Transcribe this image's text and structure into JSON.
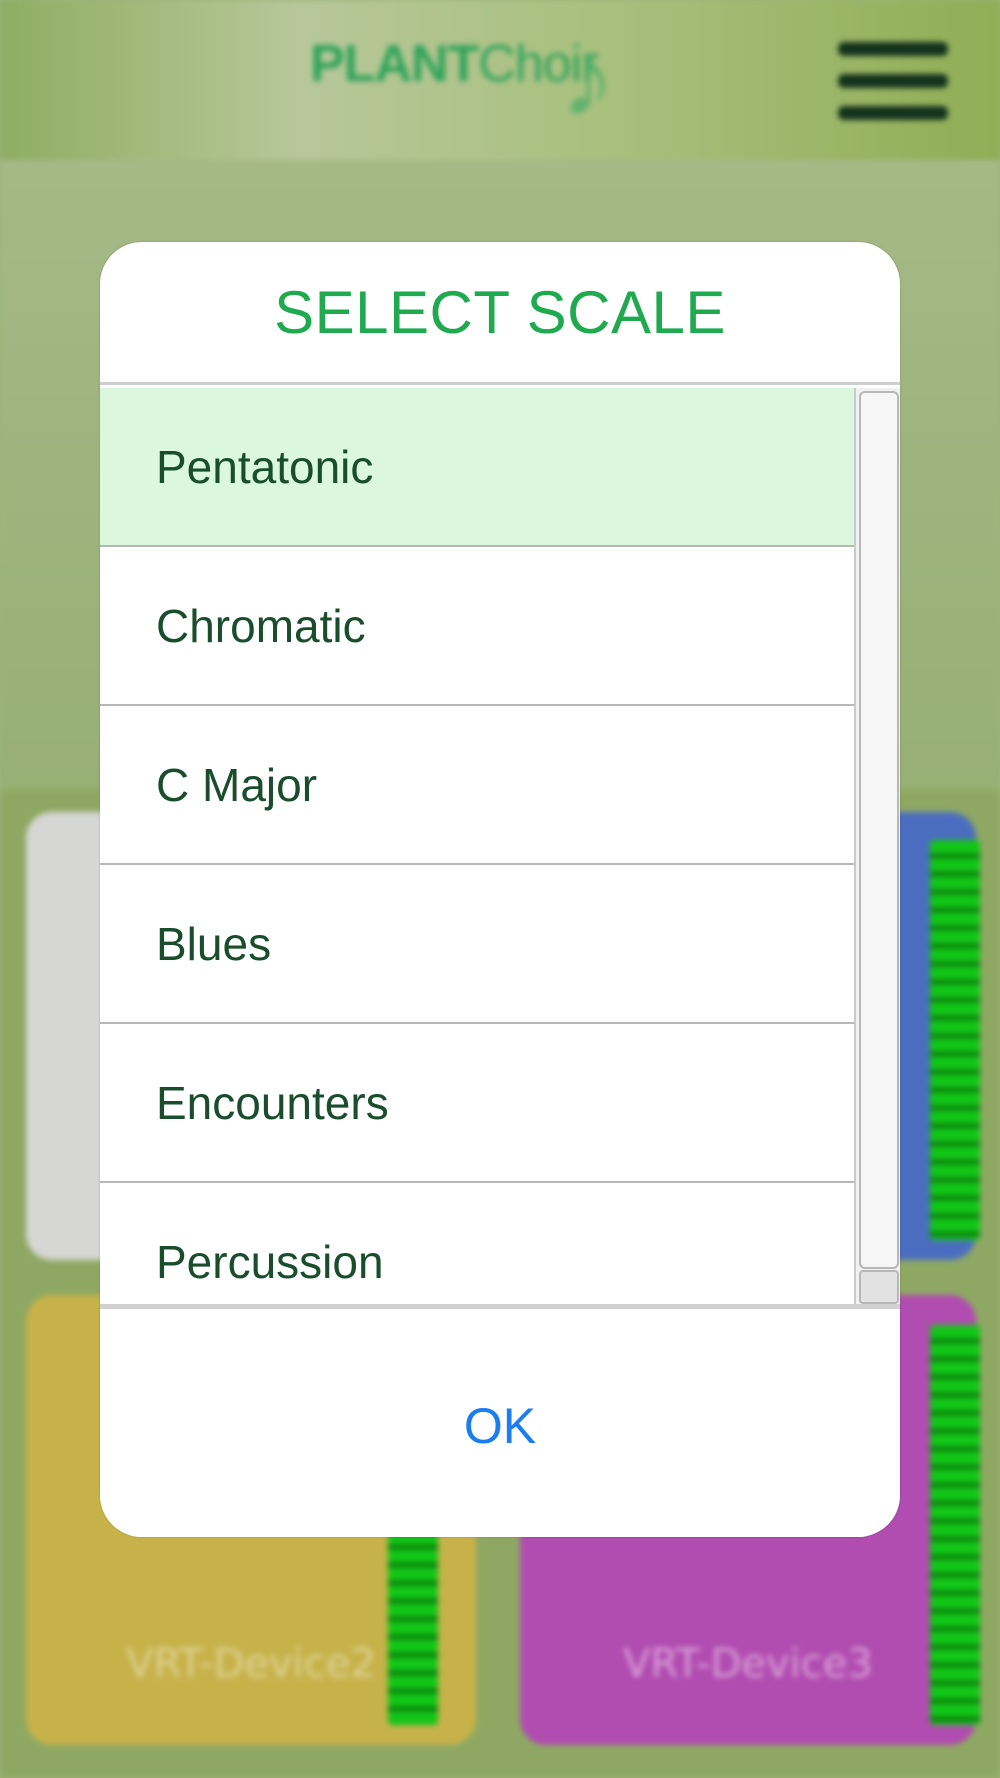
{
  "app": {
    "logo_bold": "PLANT",
    "logo_regular": "Choir",
    "menu_icon": "hamburger-menu-icon"
  },
  "background_tiles": [
    {
      "label": ""
    },
    {
      "label": ""
    },
    {
      "label": "VRT-Device2"
    },
    {
      "label": "VRT-Device3"
    }
  ],
  "dialog": {
    "title": "SELECT SCALE",
    "options": [
      {
        "label": "Pentatonic",
        "selected": true
      },
      {
        "label": "Chromatic",
        "selected": false
      },
      {
        "label": "C Major",
        "selected": false
      },
      {
        "label": "Blues",
        "selected": false
      },
      {
        "label": "Encounters",
        "selected": false
      },
      {
        "label": "Percussion",
        "selected": false
      }
    ],
    "ok_label": "OK"
  },
  "colors": {
    "title": "#1faa50",
    "selected_row": "#dbf7dd",
    "item_text": "#1a4d2b",
    "ok_text": "#1a7df2"
  }
}
